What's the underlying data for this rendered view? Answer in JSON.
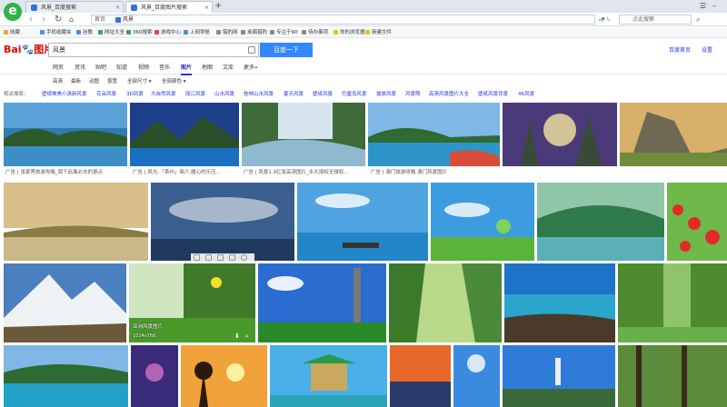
{
  "browser": {
    "tabs": [
      {
        "label": "风景_百度搜索",
        "active": false
      },
      {
        "label": "风景_百度图片搜索",
        "active": true
      }
    ],
    "new_tab": "+",
    "address": {
      "home_label": "首页",
      "url": "风景"
    },
    "search_placeholder": "点此搜索",
    "bookmarks": [
      "收藏",
      "手机收藏夹",
      "谷歌",
      "网址大全",
      "360搜索",
      "游戏中心",
      "上网导航",
      "猎豹网",
      "桌面猎豹",
      "专注于WI",
      "待办事项",
      "你的浏览器",
      "新建文件"
    ]
  },
  "baidu": {
    "logo_left": "Bai",
    "logo_mid": "du",
    "logo_right": "图片",
    "query": "风景",
    "search_button": "百度一下",
    "top_links": [
      "百度首页",
      "设置"
    ],
    "vertical_tabs": [
      "网页",
      "资讯",
      "贴吧",
      "知道",
      "视频",
      "音乐",
      "图片",
      "地图",
      "文库",
      "更多»"
    ],
    "active_tab": "图片",
    "filters": [
      "高清",
      "最新",
      "动图",
      "按宽",
      "全部尺寸 ▾",
      "全部颜色 ▾"
    ],
    "related_label": "相关搜索：",
    "related": [
      "壁纸唯美小清新风景",
      "花朵风景",
      "3D风景",
      "大自然风景",
      "丽江风景",
      "山水风景",
      "桂林山水风景",
      "夏天风景",
      "壁纸风景",
      "巴厘岛风景",
      "拔旅风景",
      "风景照",
      "高清风景图片大全",
      "壁纸风景背景",
      "4K风景"
    ]
  },
  "ads": [
    "广告 | 张家界旅游攻略_周下此离必去的景点",
    "广告 | 风光-「茶州」简介,暖心的乐压...",
    "广告 | 风景1.9亿张高清图片_永久授权无侵权...",
    "广告 | 澳门旅游攻略 澳门风景图片"
  ],
  "hover_caption": {
    "title": "亚洲风景图片",
    "size": "1024x768"
  },
  "icons": [
    "refresh-icon",
    "back-icon",
    "forward-icon",
    "camera-icon",
    "download-icon",
    "zoom-icon"
  ]
}
